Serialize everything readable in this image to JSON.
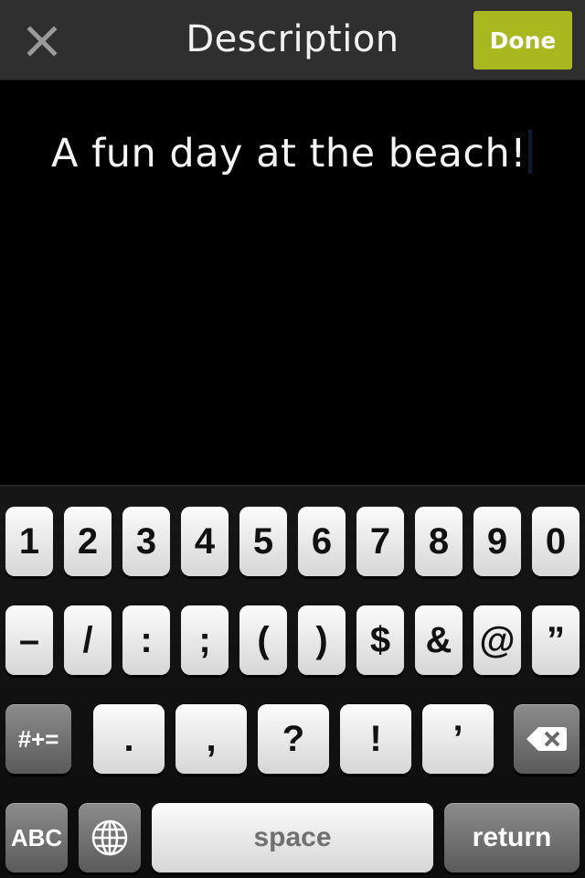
{
  "header": {
    "title": "Description",
    "done_label": "Done",
    "close_icon": "close-icon",
    "accent_color": "#a8b81f"
  },
  "editor": {
    "text": "A fun day at the beach!"
  },
  "keyboard": {
    "row1": [
      "1",
      "2",
      "3",
      "4",
      "5",
      "6",
      "7",
      "8",
      "9",
      "0"
    ],
    "row2": [
      "–",
      "/",
      ":",
      ";",
      "(",
      ")",
      "$",
      "&",
      "@",
      "”"
    ],
    "row3": {
      "toggle_label": "#+=",
      "keys": [
        ".",
        ",",
        "?",
        "!",
        "’"
      ],
      "delete_icon": "backspace-icon"
    },
    "row4": {
      "abc_label": "ABC",
      "globe_icon": "globe-icon",
      "space_label": "space",
      "return_label": "return"
    }
  }
}
